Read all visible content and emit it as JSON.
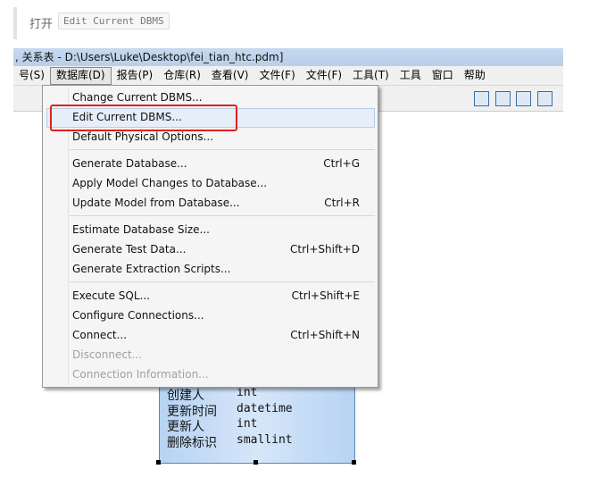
{
  "note": {
    "prefix": "打开",
    "code": "Edit Current DBMS"
  },
  "window": {
    "title": ", 关系表 - D:\\Users\\Luke\\Desktop\\fei_tian_htc.pdm]"
  },
  "menubar": [
    "号(S)",
    "数据库(D)",
    "报告(P)",
    "仓库(R)",
    "查看(V)",
    "文件(F)",
    "文件(F)",
    "工具(T)",
    "工具",
    "窗口",
    "帮助"
  ],
  "menu": {
    "items": [
      {
        "label": "Change Current DBMS...",
        "shortcut": ""
      },
      {
        "label": "Edit Current DBMS...",
        "shortcut": "",
        "highlighted": true
      },
      {
        "label": "Default Physical Options...",
        "shortcut": ""
      },
      {
        "label": "Generate Database...",
        "shortcut": "Ctrl+G"
      },
      {
        "label": "Apply Model Changes to Database...",
        "shortcut": ""
      },
      {
        "label": "Update Model from Database...",
        "shortcut": "Ctrl+R"
      },
      {
        "label": "Estimate Database Size...",
        "shortcut": ""
      },
      {
        "label": "Generate Test Data...",
        "shortcut": "Ctrl+Shift+D"
      },
      {
        "label": "Generate Extraction Scripts...",
        "shortcut": ""
      },
      {
        "label": "Execute SQL...",
        "shortcut": "Ctrl+Shift+E"
      },
      {
        "label": "Configure Connections...",
        "shortcut": ""
      },
      {
        "label": "Connect...",
        "shortcut": "Ctrl+Shift+N"
      },
      {
        "label": "Disconnect...",
        "shortcut": "",
        "disabled": true
      },
      {
        "label": "Connection Information...",
        "shortcut": "",
        "disabled": true
      }
    ]
  },
  "entity": {
    "rows": [
      {
        "name": "创建人",
        "type": "int"
      },
      {
        "name": "更新时间",
        "type": "datetime"
      },
      {
        "name": "更新人",
        "type": "int"
      },
      {
        "name": "删除标识",
        "type": "smallint"
      }
    ]
  },
  "colors": {
    "highlight_box": "#e02020",
    "entity_fill": "#c6dcf6"
  }
}
